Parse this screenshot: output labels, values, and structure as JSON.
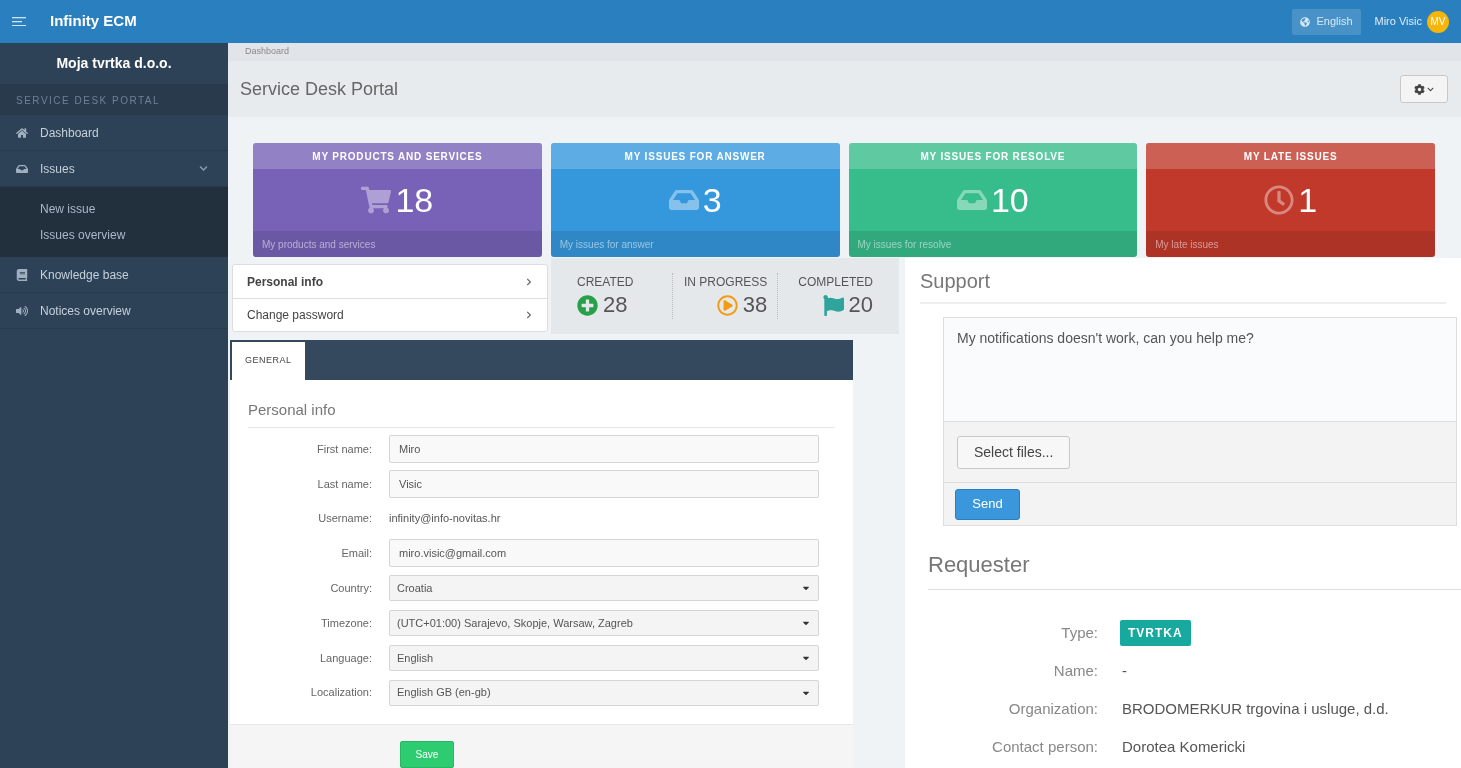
{
  "topbar": {
    "brand": "Infinity ECM",
    "language": "English",
    "user": "Miro Visic",
    "avatar": "MV"
  },
  "sidebar": {
    "company": "Moja tvrtka d.o.o.",
    "section": "SERVICE DESK PORTAL",
    "items": [
      {
        "label": "Dashboard",
        "selected": false
      },
      {
        "label": "Issues",
        "selected": false,
        "expanded": true,
        "children": [
          {
            "label": "New issue"
          },
          {
            "label": "Issues overview"
          }
        ]
      },
      {
        "label": "Knowledge base",
        "selected": false
      },
      {
        "label": "Notices overview",
        "selected": false
      }
    ]
  },
  "breadcrumb": "Dashboard",
  "page_title": "Service Desk Portal",
  "tiles": [
    {
      "title": "MY PRODUCTS AND SERVICES",
      "count": "18",
      "footer": "My products and services",
      "color": "#7862b8"
    },
    {
      "title": "MY ISSUES FOR ANSWER",
      "count": "3",
      "footer": "My issues for answer",
      "color": "#3598dc"
    },
    {
      "title": "MY ISSUES FOR RESOLVE",
      "count": "10",
      "footer": "My issues for resolve",
      "color": "#37bd8b"
    },
    {
      "title": "MY LATE ISSUES",
      "count": "1",
      "footer": "My late issues",
      "color": "#c0392b"
    }
  ],
  "profile_menu": [
    {
      "label": "Personal info",
      "selected": true
    },
    {
      "label": "Change password",
      "selected": false
    }
  ],
  "stats": [
    {
      "label": "CREATED",
      "value": "28",
      "color": "#27a04a"
    },
    {
      "label": "IN PROGRESS",
      "value": "38",
      "color": "#f39c12"
    },
    {
      "label": "COMPLETED",
      "value": "20",
      "color": "#2fa49b"
    }
  ],
  "form": {
    "tabs": [
      {
        "label": "GENERAL",
        "selected": true
      }
    ],
    "heading": "Personal info",
    "fields": [
      {
        "label": "First name:",
        "value": "Miro",
        "kind": "text"
      },
      {
        "label": "Last name:",
        "value": "Visic",
        "kind": "text"
      },
      {
        "label": "Username:",
        "value": "infinity@info-novitas.hr",
        "kind": "static"
      },
      {
        "label": "Email:",
        "value": "miro.visic@gmail.com",
        "kind": "text"
      },
      {
        "label": "Country:",
        "value": "Croatia",
        "kind": "select"
      },
      {
        "label": "Timezone:",
        "value": "(UTC+01:00) Sarajevo, Skopje, Warsaw, Zagreb",
        "kind": "select"
      },
      {
        "label": "Language:",
        "value": "English",
        "kind": "select"
      },
      {
        "label": "Localization:",
        "value": "English GB (en-gb)",
        "kind": "select"
      }
    ],
    "save": "Save"
  },
  "support": {
    "heading": "Support",
    "message": "My notifications doesn't work, can you help me?",
    "select_files": "Select files...",
    "send": "Send"
  },
  "requester": {
    "heading": "Requester",
    "rows": [
      {
        "label": "Type:",
        "value": "TVRTKA",
        "kind": "badge"
      },
      {
        "label": "Name:",
        "value": "-",
        "kind": "text"
      },
      {
        "label": "Organization:",
        "value": "BRODOMERKUR trgovina i usluge, d.d.",
        "kind": "text"
      },
      {
        "label": "Contact person:",
        "value": "Dorotea Komericki",
        "kind": "text"
      }
    ]
  }
}
